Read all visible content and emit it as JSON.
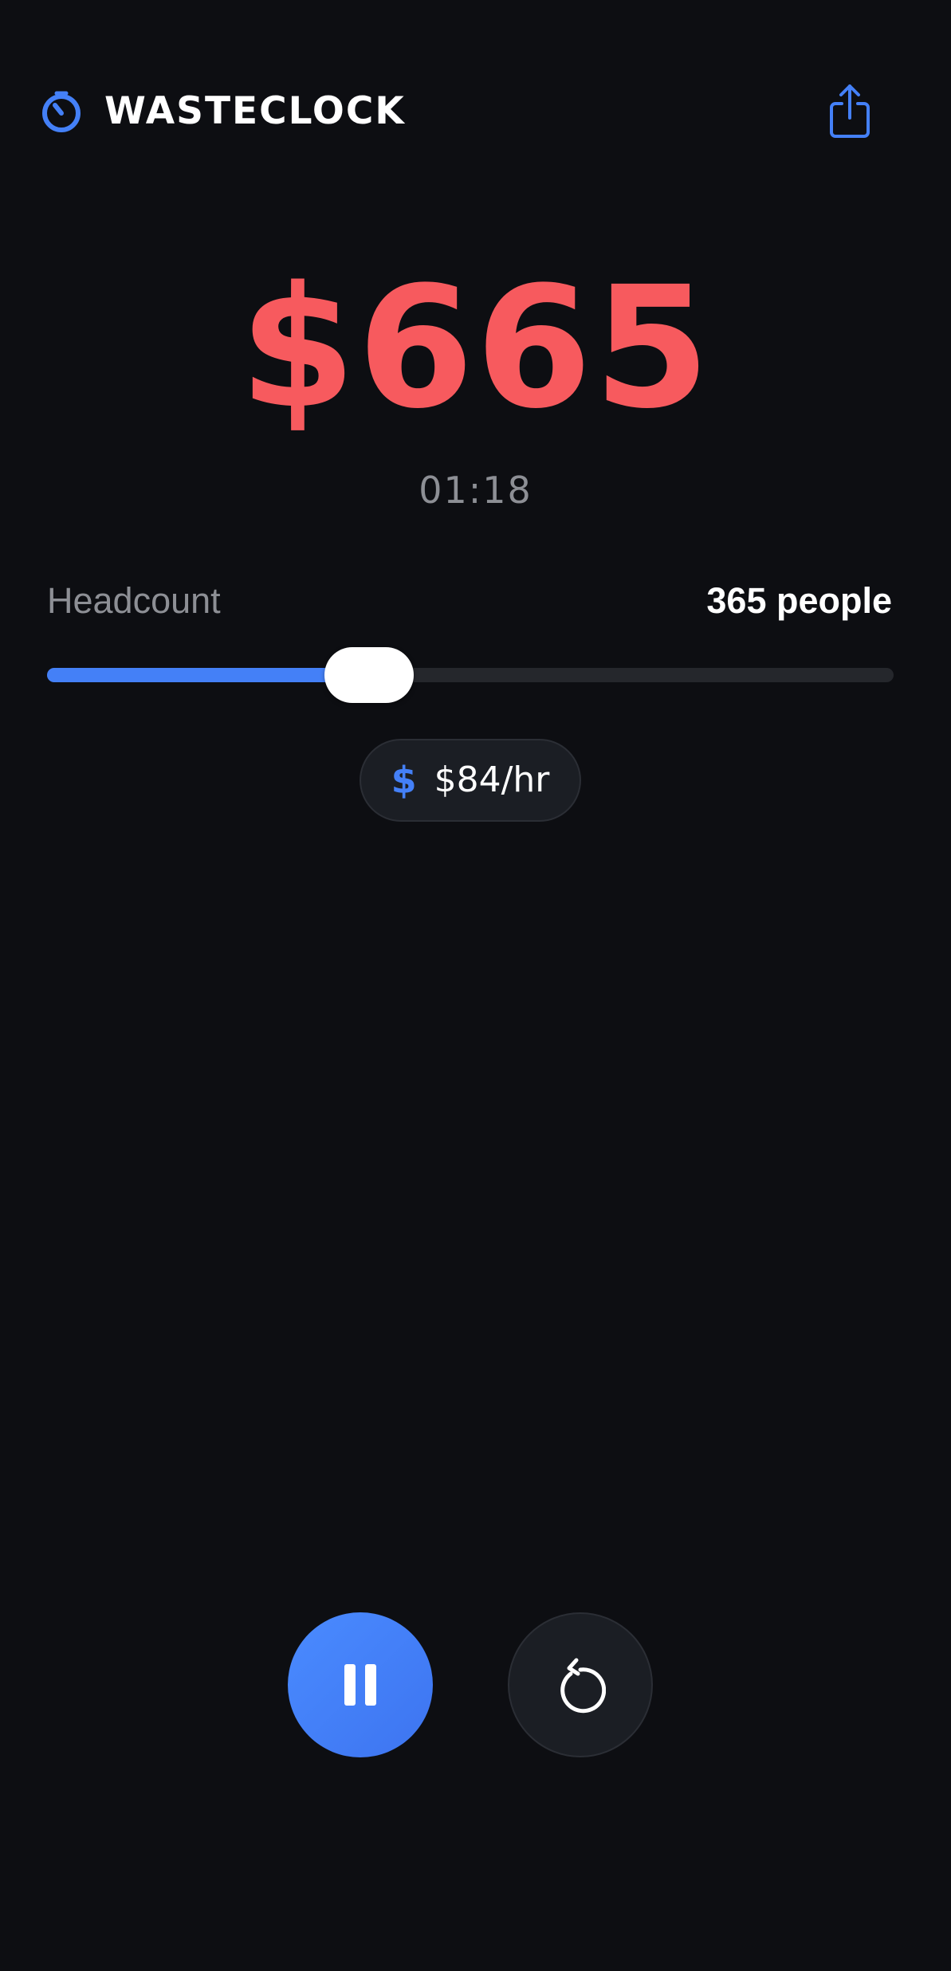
{
  "header": {
    "brand": "WASTECLOCK",
    "logo_icon": "timer-icon",
    "share_icon": "share-icon"
  },
  "cost": {
    "amount": "$665",
    "elapsed": "01:18"
  },
  "headcount": {
    "label": "Headcount",
    "value_text": "365 people",
    "slider_fraction": 0.38
  },
  "rate": {
    "icon": "dollar-icon",
    "icon_glyph": "$",
    "text": "$84/hr"
  },
  "controls": {
    "pause_icon": "pause-icon",
    "reset_icon": "reset-icon"
  },
  "colors": {
    "background": "#0d0e12",
    "accent": "#4480f7",
    "amount": "#f75a5e",
    "muted_text": "#8d8f95"
  }
}
